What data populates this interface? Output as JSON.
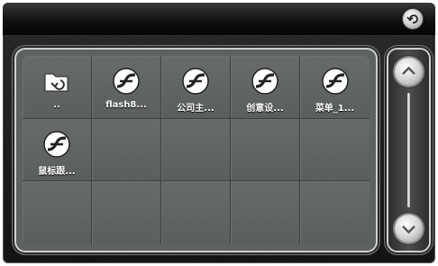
{
  "header": {
    "back_icon": "back-arrow-icon"
  },
  "grid": {
    "items": [
      {
        "label": "..",
        "icon": "folder-up-icon"
      },
      {
        "label": "flash8...",
        "icon": "flash-file-icon"
      },
      {
        "label": "公司主...",
        "icon": "flash-file-icon"
      },
      {
        "label": "创意设...",
        "icon": "flash-file-icon"
      },
      {
        "label": "菜单_1...",
        "icon": "flash-file-icon"
      },
      {
        "label": "鼠标跟...",
        "icon": "flash-file-icon"
      }
    ],
    "empty_cells": 9
  },
  "scrollbar": {
    "up_icon": "chevron-up-icon",
    "down_icon": "chevron-down-icon"
  }
}
